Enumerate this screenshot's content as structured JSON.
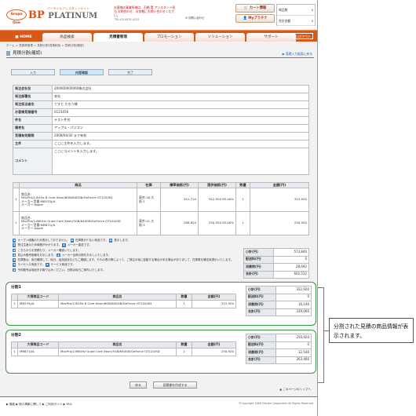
{
  "header": {
    "logo_oval": "Grupo One",
    "logo_bp": "BP",
    "logo_platinum": "PLATINUM",
    "tagline": "バーチャルアシスタントサイト",
    "notice": "お客様の事業所様は、石橋 実 アシスタント担当 お問合わせ、お気軽にお問い合わせください。",
    "tel": "TEL:03-4574-4222",
    "inquiry": "お問い合わせ",
    "cart_button": "カート情報",
    "myplatina_button": "Myプラチナ",
    "cart_count_label": "商品数",
    "cart_count_value": "0",
    "cart_total_label": "合計金額",
    "cart_total_value": "0"
  },
  "nav": {
    "tabs": [
      "HOME",
      "商品検索",
      "見積書管理",
      "プロモーション",
      "ソリューション",
      "サポート"
    ],
    "logout": "ログアウト"
  },
  "breadcrumb": "ホーム > 見積書管理 > 見積分割/見積削除 > 見積分割(確認)",
  "page_title": "見積分割(確認)",
  "back_link": "見積入力画面に戻る",
  "steps": [
    "入力",
    "内容確認",
    "完了"
  ],
  "info_rows": [
    {
      "label": "発注会社名",
      "value": "200000000000株式会社"
    },
    {
      "label": "発注部署名",
      "value": "本社"
    },
    {
      "label": "発注担当者名",
      "value": "てすと たろう様"
    },
    {
      "label": "お客様見積番号",
      "value": "0123456"
    },
    {
      "label": "件名",
      "value": "テスト件名"
    },
    {
      "label": "備考名",
      "value": "アップル・パソコン"
    },
    {
      "label": "見積有効期限",
      "value": "2008/04/30 まで有効"
    },
    {
      "label": "主件",
      "value": "ここに主件を入力します。"
    },
    {
      "label": "コメント",
      "value": "ここにコメントを入力します。"
    }
  ],
  "items": {
    "headers": [
      "",
      "商品",
      "在庫",
      "標準価格(円)",
      "提供価格(円)",
      "数量",
      "金額(円)"
    ],
    "rows": [
      {
        "no": "1",
        "name_label": "商品名:",
        "name": "MacPro/2.8GHz 8 Core Xeon/6GB/640GB/GeForce GT120/SD",
        "model": "メーカー型番:MB535J/A",
        "maker": "メーカー:Apple",
        "stock": "東京:16 大阪:1",
        "list": "341,714",
        "price": "322,920 95.00%",
        "qty": "1",
        "amount": "322,920"
      },
      {
        "no": "2",
        "name_label": "商品名:",
        "name": "MacPro/2.66GHz Quad Core Xeon/3GB/640GB/GeForce GT120/SD",
        "model": "メーカー型番:MB871J/A",
        "maker": "メーカー:Apple",
        "stock": "東京:21 大阪:5",
        "list": "268,824",
        "price": "250,920 95.00%",
        "qty": "1",
        "amount": "250,920"
      }
    ]
  },
  "legend": [
    "オープン価格のため表示しておりません。",
    "在庫数が少ない商品です。",
    "表示します。",
    "受注生産のため時間がかかります。",
    "メーカー直送です。",
    "こちらからお見積もり、メーカー確認いたします。",
    "見込み販売価格をお示します。",
    "メーカー出荷の際をお示しいたします。",
    "在庫数は、後日確認して、後日、返品回収などもご連絡します。それの表示等によって、ご発注の後に変動する場合がある場合がありまして、在庫数を確定後提示いたします。",
    "ライセンス商品です。",
    "サービス商品です。",
    "予約販売は商品をお取り込みください。日程は後日ご案内いたします。"
  ],
  "totals": [
    {
      "label": "小計(円)",
      "value": "573,840"
    },
    {
      "label": "配送料(円)",
      "value": "0"
    },
    {
      "label": "消費税(円)",
      "value": "28,692"
    },
    {
      "label": "合計(円)",
      "value": "602,532"
    }
  ],
  "divisions": [
    {
      "title": "分割1",
      "headers": [
        "",
        "大塚商品コード",
        "商品名",
        "数量",
        "金額(円)"
      ],
      "row": {
        "no": "1",
        "code": "MB535J/A",
        "name": "MacPro/2.8GHz 8 Core Xeon/6GB/640GB/GeForce GT120/SD",
        "qty": "1",
        "amount": "322,920"
      },
      "totals": [
        {
          "label": "小計(円)",
          "value": "322,920"
        },
        {
          "label": "配送料(円)",
          "value": "0"
        },
        {
          "label": "消費税(円)",
          "value": "16,146"
        },
        {
          "label": "合計(円)",
          "value": "339,066"
        }
      ]
    },
    {
      "title": "分割2",
      "headers": [
        "",
        "大塚商品コード",
        "商品名",
        "数量",
        "金額(円)"
      ],
      "row": {
        "no": "1",
        "code": "MB871J/A",
        "name": "MacPro/2.66GHz Quad Core Xeon/3GB/640GB/GeForce GT120/SD",
        "qty": "1",
        "amount": "250,920"
      },
      "totals": [
        {
          "label": "小計(円)",
          "value": "250,920"
        },
        {
          "label": "配送料(円)",
          "value": "0"
        },
        {
          "label": "消費税(円)",
          "value": "12,546"
        },
        {
          "label": "合計(円)",
          "value": "263,466"
        }
      ]
    }
  ],
  "buttons": {
    "back": "戻る",
    "create": "見積書を作成する"
  },
  "pagetop": "このページのトップへ",
  "footer": {
    "links": "▶ 機能  ▶ 個人情報に関して  ▶ ご利用ガイド  ▶ FAQ",
    "copy": "©Copyright 2009 Otsuka Corporation All Rights Reserved"
  },
  "callout": "分割された見積の商品情報が表示されます。",
  "colors": {
    "accent": "#d85818",
    "frame": "#3a9a4a"
  }
}
